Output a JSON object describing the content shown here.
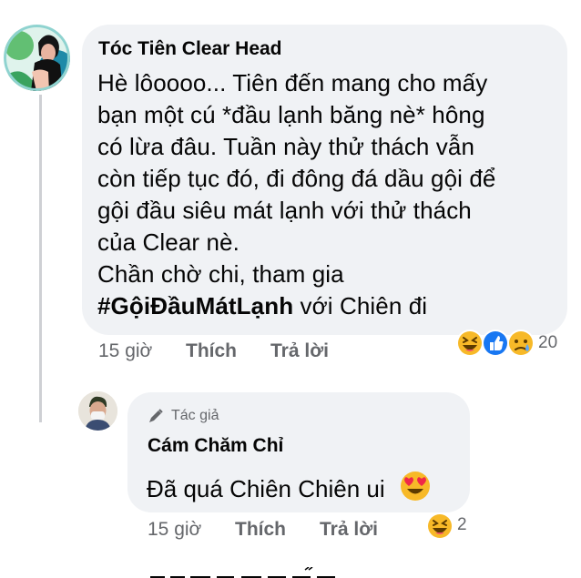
{
  "comment": {
    "author": "Tóc Tiên Clear Head",
    "text_lines": [
      "Hè lôoooo... Tiên đến mang cho mấy",
      "bạn một cú *đầu lạnh băng nè* hông",
      "có lừa đâu. Tuần này thử thách vẫn",
      "còn tiếp tục đó, đi đông đá dầu gội để",
      "gội đầu siêu mát lạnh với thử thách",
      "của Clear nè.",
      "Chần chờ chi, tham gia"
    ],
    "hashtag": "#GộiĐầuMátLạnh",
    "hashtag_suffix": " với Chiên đi",
    "time": "15 giờ",
    "like_label": "Thích",
    "reply_label": "Trả lời",
    "reaction_count": "20",
    "reaction_icons": [
      "laugh-emoji",
      "like-emoji",
      "sad-emoji"
    ]
  },
  "reply": {
    "badge": "Tác giả",
    "author": "Cám Chăm Chỉ",
    "text": "Đã quá Chiên Chiên ui",
    "emoji": "heart-eyes-emoji",
    "time": "15 giờ",
    "like_label": "Thích",
    "reply_label": "Trả lời",
    "reaction_count": "2",
    "reaction_icons": [
      "laugh-emoji"
    ]
  },
  "colors": {
    "bubble": "#f0f2f5",
    "meta_text": "#65676b",
    "like_blue": "#1877f2",
    "emoji_yellow": "#f7b928"
  }
}
